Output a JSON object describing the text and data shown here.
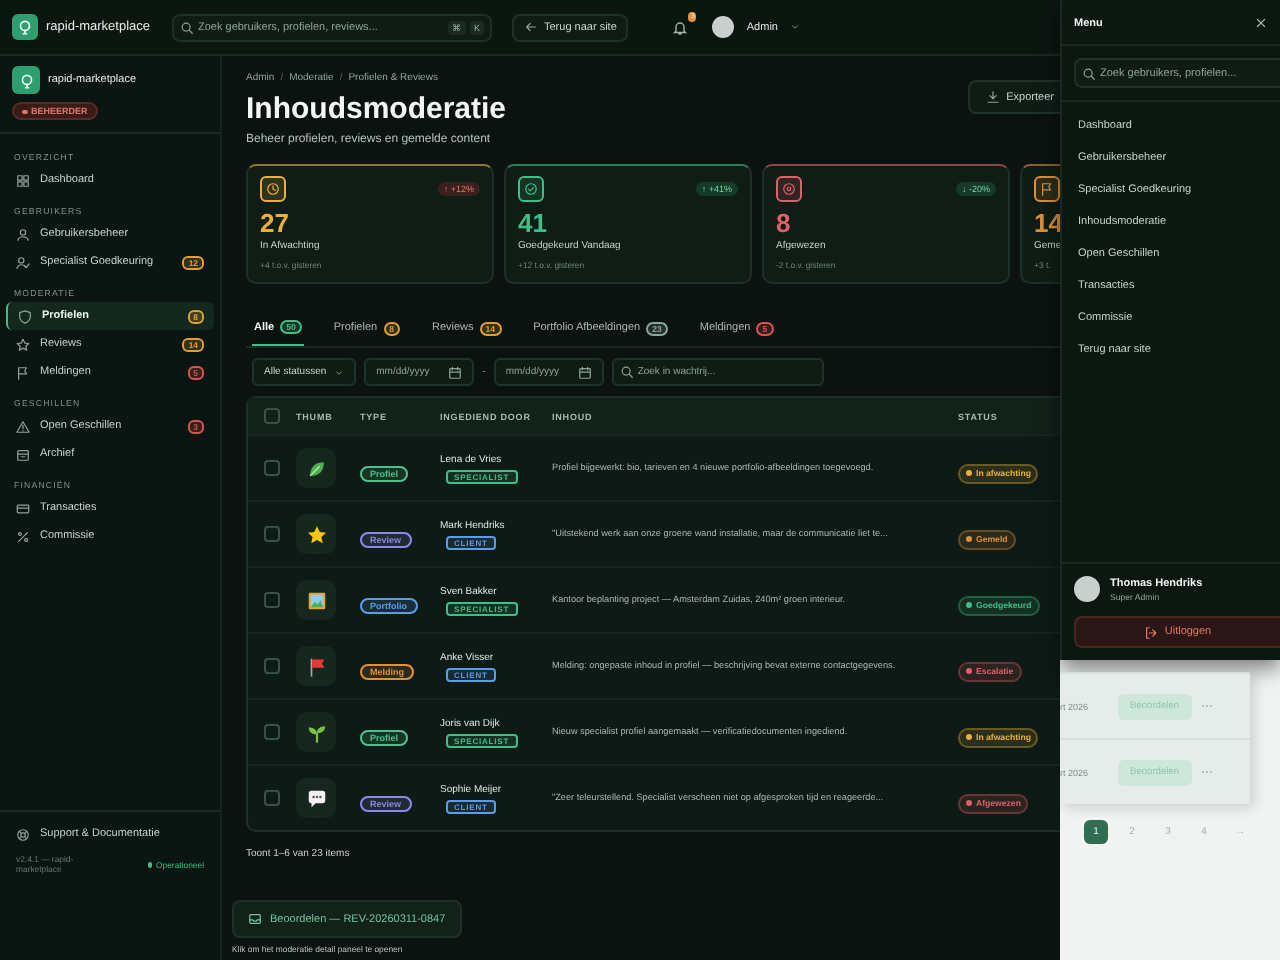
{
  "topbar": {
    "brand": "rapid-marketplace",
    "search": {
      "placeholder": "Zoek gebruikers, profielen, reviews...",
      "keys": [
        "⌘",
        "K"
      ]
    },
    "back_button": "Terug naar site",
    "notifications": "3",
    "user": "Admin"
  },
  "sidebar": {
    "brand": "rapid-marketplace",
    "role_badge": "BEHEERDER",
    "sections": [
      {
        "title": "OVERZICHT",
        "items": [
          {
            "kind": "grid",
            "label": "Dashboard",
            "selected": false
          }
        ]
      },
      {
        "title": "GEBRUIKERS",
        "items": [
          {
            "kind": "user",
            "label": "Gebruikersbeheer",
            "selected": false
          },
          {
            "kind": "usercheck",
            "label": "Specialist Goedkeuring",
            "badge": "12",
            "color": "#e0a030",
            "selected": false
          }
        ]
      },
      {
        "title": "MODERATIE",
        "items": [
          {
            "kind": "shield",
            "label": "Profielen",
            "badge": "8",
            "color": "#e0a030",
            "selected": true
          },
          {
            "kind": "star",
            "label": "Reviews",
            "badge": "14",
            "color": "#e0a030",
            "selected": false
          },
          {
            "kind": "flag",
            "label": "Meldingen",
            "badge": "5",
            "color": "#d9534f",
            "selected": false
          }
        ]
      },
      {
        "title": "GESCHILLEN",
        "items": [
          {
            "kind": "alert",
            "label": "Open Geschillen",
            "badge": "3",
            "color": "#d9534f",
            "selected": false
          },
          {
            "kind": "archive",
            "label": "Archief",
            "selected": false
          }
        ]
      },
      {
        "title": "FINANCIËN",
        "items": [
          {
            "kind": "card",
            "label": "Transacties",
            "selected": false
          },
          {
            "kind": "percent",
            "label": "Commissie",
            "selected": false
          }
        ]
      }
    ],
    "support": "Support & Documentatie",
    "version": "v2.4.1 — rapid-marketplace",
    "status": "Operationeel"
  },
  "breadcrumb": {
    "items": [
      "Admin",
      "Moderatie",
      "Profielen & Reviews"
    ],
    "separator": "/"
  },
  "title": "Inhoudsmoderatie",
  "subtitle": "Beheer profielen, reviews en gemelde content",
  "export_button": "Exporteer",
  "stats": [
    {
      "kind": "clock",
      "color": "#e8b23a",
      "value": "27",
      "label": "In Afwachting",
      "delta": "↑ +12%",
      "delta_up": false,
      "note": "+4 t.o.v. gisteren"
    },
    {
      "kind": "check",
      "color": "#3fbf86",
      "value": "41",
      "label": "Goedgekeurd Vandaag",
      "delta": "↑ +41%",
      "delta_up": true,
      "note": "+12 t.o.v. gisteren"
    },
    {
      "kind": "xcircle",
      "color": "#e0606a",
      "value": "8",
      "label": "Afgewezen",
      "delta": "↓ -20%",
      "delta_up": true,
      "note": "-2 t.o.v. gisteren"
    },
    {
      "kind": "flag",
      "color": "#e0903a",
      "value": "14",
      "label": "Geme",
      "note": "+3 t."
    }
  ],
  "tabs": [
    {
      "label": "Alle",
      "count": "50",
      "color": "#3fbf86",
      "selected": true
    },
    {
      "label": "Profielen",
      "count": "8",
      "color": "#e0a030",
      "selected": false
    },
    {
      "label": "Reviews",
      "count": "14",
      "color": "#e0a030",
      "selected": false
    },
    {
      "label": "Portfolio Afbeeldingen",
      "count": "23",
      "color": "#8aa59a",
      "selected": false
    },
    {
      "label": "Meldingen",
      "count": "5",
      "color": "#d9534f",
      "selected": false
    }
  ],
  "filters": {
    "status": "Alle statussen",
    "date_from": "mm/dd/yyyy",
    "separator": "-",
    "date_to": "mm/dd/yyyy",
    "search_placeholder": "Zoek in wachtrij..."
  },
  "table": {
    "select_all_checked": false,
    "columns": [
      "THUMB",
      "TYPE",
      "INGEDIEND DOOR",
      "INHOUD",
      "STATUS"
    ],
    "rows": [
      {
        "checked": false,
        "thumb": {
          "kind": "leaf"
        },
        "type": {
          "label": "Profiel",
          "color": "#4fc08d"
        },
        "name": "Lena de Vries",
        "role": {
          "label": "SPECIALIST",
          "color": "#3fbf86"
        },
        "content": "Profiel bijgewerkt: bio, tarieven en 4 nieuwe portfolio-afbeeldingen toegevoegd.",
        "status": {
          "label": "In afwachting",
          "color": "#e8b23a"
        }
      },
      {
        "checked": false,
        "thumb": {
          "kind": "star"
        },
        "type": {
          "label": "Review",
          "color": "#8f86e8"
        },
        "name": "Mark Hendriks",
        "role": {
          "label": "CLIENT",
          "color": "#5b9be8"
        },
        "content": "\"Uitstekend werk aan onze groene wand installatie, maar de communicatie liet te...",
        "status": {
          "label": "Gemeld",
          "color": "#e0903a"
        }
      },
      {
        "checked": false,
        "thumb": {
          "kind": "picture"
        },
        "type": {
          "label": "Portfolio",
          "color": "#5b9be8"
        },
        "name": "Sven Bakker",
        "role": {
          "label": "SPECIALIST",
          "color": "#3fbf86"
        },
        "content": "Kantoor beplanting project — Amsterdam Zuidas, 240m² groen interieur.",
        "status": {
          "label": "Goedgekeurd",
          "color": "#3fbf86"
        }
      },
      {
        "checked": false,
        "thumb": {
          "kind": "flag"
        },
        "type": {
          "label": "Melding",
          "color": "#e0903a"
        },
        "name": "Anke Visser",
        "role": {
          "label": "CLIENT",
          "color": "#5b9be8"
        },
        "content": "Melding: ongepaste inhoud in profiel — beschrijving bevat externe contactgegevens.",
        "status": {
          "label": "Escalatie",
          "color": "#e0606a"
        }
      },
      {
        "checked": false,
        "thumb": {
          "kind": "sprout"
        },
        "type": {
          "label": "Profiel",
          "color": "#4fc08d"
        },
        "name": "Joris van Dijk",
        "role": {
          "label": "SPECIALIST",
          "color": "#3fbf86"
        },
        "content": "Nieuw specialist profiel aangemaakt — verificatiedocumenten ingediend.",
        "status": {
          "label": "In afwachting",
          "color": "#e8b23a"
        }
      },
      {
        "checked": false,
        "thumb": {
          "kind": "speech"
        },
        "type": {
          "label": "Review",
          "color": "#8f86e8"
        },
        "name": "Sophie Meijer",
        "role": {
          "label": "CLIENT",
          "color": "#5b9be8"
        },
        "content": "\"Zeer teleurstellend. Specialist verscheen niet op afgesproken tijd en reageerde...",
        "status": {
          "label": "Afgewezen",
          "color": "#e0606a"
        }
      }
    ]
  },
  "table_footer": "Toont 1–6 van 23 items",
  "review_button": "Beoordelen — REV-20260311-0847",
  "review_hint": "Klik om het moderatie detail paneel te openen",
  "drawer": {
    "title": "Menu",
    "search_placeholder": "Zoek gebruikers, profielen...",
    "items": [
      "Dashboard",
      "Gebruikersbeheer",
      "Specialist Goedkeuring",
      "Inhoudsmoderatie",
      "Open Geschillen",
      "Transacties",
      "Commissie",
      "Terug naar site"
    ],
    "user_name": "Thomas Hendriks",
    "user_role": "Super Admin",
    "logout": "Uitloggen"
  },
  "peek": {
    "rows": [
      {
        "date": "rt 2026",
        "action": "Beoordelen",
        "more": "⋯"
      },
      {
        "date": "rt 2026",
        "action": "Beoordelen",
        "more": "⋯"
      }
    ],
    "pages": [
      {
        "label": "1",
        "selected": true
      },
      {
        "label": "2",
        "selected": false
      },
      {
        "label": "3",
        "selected": false
      },
      {
        "label": "4",
        "selected": false
      },
      {
        "label": "→",
        "selected": false
      }
    ]
  }
}
